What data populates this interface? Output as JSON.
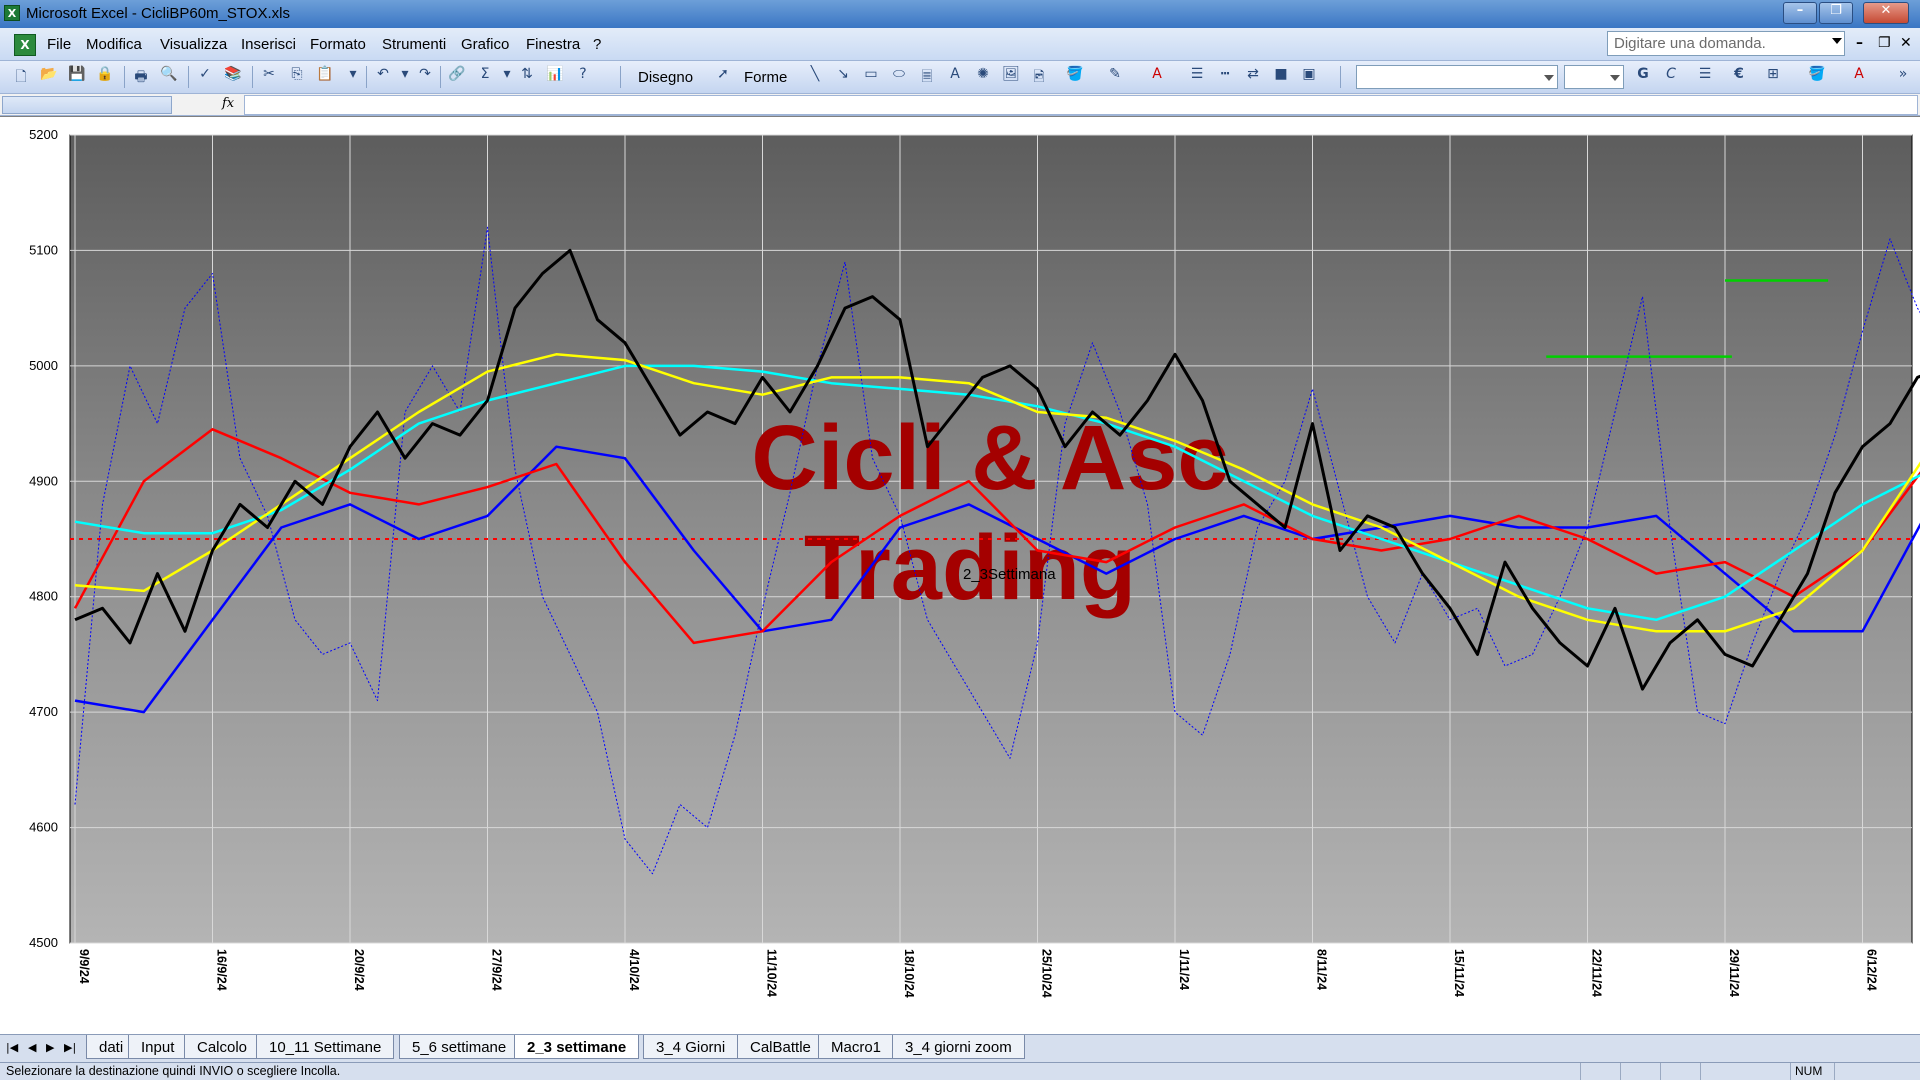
{
  "window": {
    "app_icon": "excel-app-icon",
    "title": "Microsoft Excel - CicliBP60m_STOX.xls",
    "buttons": {
      "minimize": "minimize-icon",
      "restore": "restore-icon",
      "close": "close-icon"
    }
  },
  "menu": {
    "items": [
      "File",
      "Modifica",
      "Visualizza",
      "Inserisci",
      "Formato",
      "Strumenti",
      "Grafico",
      "Finestra",
      "?"
    ],
    "ask_placeholder": "Digitare una domanda."
  },
  "toolbar": {
    "draw_label": "Disegno",
    "shapes_label": "Forme",
    "bold_label": "G",
    "italic_label": "C",
    "euro_label": "€",
    "sigma_label": "Σ"
  },
  "formula_bar": {
    "fx_label": "fx",
    "name_value": "",
    "formula_value": ""
  },
  "chart_data": {
    "type": "line",
    "watermark_lines": [
      "Cicli & Asc",
      "Trading"
    ],
    "chart_label": "2_3Settimana",
    "y_ticks": [
      "5200",
      "5100",
      "5000",
      "4900",
      "4800",
      "4700",
      "4600",
      "4500"
    ],
    "ylim": [
      4500,
      5200
    ],
    "x_ticks": [
      "9/9/24",
      "16/9/24",
      "20/9/24",
      "27/9/24",
      "4/10/24",
      "11/10/24",
      "18/10/24",
      "25/10/24",
      "1/11/24",
      "8/11/24",
      "15/11/24",
      "22/11/24",
      "29/11/24",
      "6/12/24"
    ],
    "reference_line": {
      "value": 4850,
      "color": "#ff0000"
    },
    "target_levels": [
      {
        "from_tick": 10.7,
        "to_tick": 12.05,
        "value": 5008,
        "color": "#00d000"
      },
      {
        "from_tick": 12.0,
        "to_tick": 12.75,
        "value": 5074,
        "color": "#00d000"
      }
    ],
    "series": [
      {
        "color": "#000000",
        "width": 3,
        "style": "solid",
        "points": [
          [
            0,
            4780
          ],
          [
            0.2,
            4790
          ],
          [
            0.4,
            4760
          ],
          [
            0.6,
            4820
          ],
          [
            0.8,
            4770
          ],
          [
            1.0,
            4840
          ],
          [
            1.2,
            4880
          ],
          [
            1.4,
            4860
          ],
          [
            1.6,
            4900
          ],
          [
            1.8,
            4880
          ],
          [
            2.0,
            4930
          ],
          [
            2.2,
            4960
          ],
          [
            2.4,
            4920
          ],
          [
            2.6,
            4950
          ],
          [
            2.8,
            4940
          ],
          [
            3.0,
            4970
          ],
          [
            3.2,
            5050
          ],
          [
            3.4,
            5080
          ],
          [
            3.6,
            5100
          ],
          [
            3.8,
            5040
          ],
          [
            4.0,
            5020
          ],
          [
            4.2,
            4980
          ],
          [
            4.4,
            4940
          ],
          [
            4.6,
            4960
          ],
          [
            4.8,
            4950
          ],
          [
            5.0,
            4990
          ],
          [
            5.2,
            4960
          ],
          [
            5.4,
            5000
          ],
          [
            5.6,
            5050
          ],
          [
            5.8,
            5060
          ],
          [
            6.0,
            5040
          ],
          [
            6.2,
            4930
          ],
          [
            6.4,
            4960
          ],
          [
            6.6,
            4990
          ],
          [
            6.8,
            5000
          ],
          [
            7.0,
            4980
          ],
          [
            7.2,
            4930
          ],
          [
            7.4,
            4960
          ],
          [
            7.6,
            4940
          ],
          [
            7.8,
            4970
          ],
          [
            8.0,
            5010
          ],
          [
            8.2,
            4970
          ],
          [
            8.4,
            4900
          ],
          [
            8.6,
            4880
          ],
          [
            8.8,
            4860
          ],
          [
            9.0,
            4950
          ],
          [
            9.2,
            4840
          ],
          [
            9.4,
            4870
          ],
          [
            9.6,
            4860
          ],
          [
            9.8,
            4820
          ],
          [
            10.0,
            4790
          ],
          [
            10.2,
            4750
          ],
          [
            10.4,
            4830
          ],
          [
            10.6,
            4790
          ],
          [
            10.8,
            4760
          ],
          [
            11.0,
            4740
          ],
          [
            11.2,
            4790
          ],
          [
            11.4,
            4720
          ],
          [
            11.6,
            4760
          ],
          [
            11.8,
            4780
          ],
          [
            12.0,
            4750
          ],
          [
            12.2,
            4740
          ],
          [
            12.4,
            4780
          ],
          [
            12.6,
            4820
          ],
          [
            12.8,
            4890
          ],
          [
            13.0,
            4930
          ],
          [
            13.2,
            4950
          ],
          [
            13.4,
            4990
          ],
          [
            13.6,
            5000
          ],
          [
            13.8,
            4990
          ]
        ]
      },
      {
        "color": "#ffff00",
        "width": 2.5,
        "style": "solid",
        "points": [
          [
            0,
            4810
          ],
          [
            0.5,
            4805
          ],
          [
            1.0,
            4840
          ],
          [
            1.5,
            4880
          ],
          [
            2.0,
            4920
          ],
          [
            2.5,
            4960
          ],
          [
            3.0,
            4995
          ],
          [
            3.5,
            5010
          ],
          [
            4.0,
            5005
          ],
          [
            4.5,
            4985
          ],
          [
            5.0,
            4975
          ],
          [
            5.5,
            4990
          ],
          [
            6.0,
            4990
          ],
          [
            6.5,
            4985
          ],
          [
            7.0,
            4960
          ],
          [
            7.5,
            4955
          ],
          [
            8.0,
            4935
          ],
          [
            8.5,
            4910
          ],
          [
            9.0,
            4880
          ],
          [
            9.5,
            4860
          ],
          [
            10.0,
            4830
          ],
          [
            10.5,
            4800
          ],
          [
            11.0,
            4780
          ],
          [
            11.5,
            4770
          ],
          [
            12.0,
            4770
          ],
          [
            12.5,
            4790
          ],
          [
            13.0,
            4840
          ],
          [
            13.5,
            4930
          ],
          [
            13.9,
            4970
          ]
        ]
      },
      {
        "color": "#00ffff",
        "width": 2.5,
        "style": "solid",
        "points": [
          [
            0,
            4865
          ],
          [
            0.5,
            4855
          ],
          [
            1.0,
            4855
          ],
          [
            1.5,
            4875
          ],
          [
            2.0,
            4910
          ],
          [
            2.5,
            4950
          ],
          [
            3.0,
            4970
          ],
          [
            3.5,
            4985
          ],
          [
            4.0,
            5000
          ],
          [
            4.5,
            5000
          ],
          [
            5.0,
            4995
          ],
          [
            5.5,
            4985
          ],
          [
            6.0,
            4980
          ],
          [
            6.5,
            4975
          ],
          [
            7.0,
            4965
          ],
          [
            7.5,
            4950
          ],
          [
            8.0,
            4930
          ],
          [
            8.5,
            4900
          ],
          [
            9.0,
            4870
          ],
          [
            9.5,
            4850
          ],
          [
            10.0,
            4830
          ],
          [
            10.5,
            4810
          ],
          [
            11.0,
            4790
          ],
          [
            11.5,
            4780
          ],
          [
            12.0,
            4800
          ],
          [
            12.5,
            4840
          ],
          [
            13.0,
            4880
          ],
          [
            13.5,
            4910
          ],
          [
            13.9,
            4935
          ]
        ]
      },
      {
        "color": "#ff0000",
        "width": 2.5,
        "style": "solid",
        "points": [
          [
            0,
            4790
          ],
          [
            0.5,
            4900
          ],
          [
            1.0,
            4945
          ],
          [
            1.5,
            4920
          ],
          [
            2.0,
            4890
          ],
          [
            2.5,
            4880
          ],
          [
            3.0,
            4895
          ],
          [
            3.5,
            4915
          ],
          [
            4.0,
            4830
          ],
          [
            4.5,
            4760
          ],
          [
            5.0,
            4770
          ],
          [
            5.5,
            4830
          ],
          [
            6.0,
            4870
          ],
          [
            6.5,
            4900
          ],
          [
            7.0,
            4840
          ],
          [
            7.5,
            4830
          ],
          [
            8.0,
            4860
          ],
          [
            8.5,
            4880
          ],
          [
            9.0,
            4850
          ],
          [
            9.5,
            4840
          ],
          [
            10.0,
            4850
          ],
          [
            10.5,
            4870
          ],
          [
            11.0,
            4850
          ],
          [
            11.5,
            4820
          ],
          [
            12.0,
            4830
          ],
          [
            12.5,
            4800
          ],
          [
            13.0,
            4840
          ],
          [
            13.5,
            4920
          ],
          [
            13.9,
            4860
          ]
        ]
      },
      {
        "color": "#0000ff",
        "width": 2.5,
        "style": "solid",
        "points": [
          [
            0,
            4710
          ],
          [
            0.5,
            4700
          ],
          [
            1.0,
            4780
          ],
          [
            1.5,
            4860
          ],
          [
            2.0,
            4880
          ],
          [
            2.5,
            4850
          ],
          [
            3.0,
            4870
          ],
          [
            3.5,
            4930
          ],
          [
            4.0,
            4920
          ],
          [
            4.5,
            4840
          ],
          [
            5.0,
            4770
          ],
          [
            5.5,
            4780
          ],
          [
            6.0,
            4860
          ],
          [
            6.5,
            4880
          ],
          [
            7.0,
            4850
          ],
          [
            7.5,
            4820
          ],
          [
            8.0,
            4850
          ],
          [
            8.5,
            4870
          ],
          [
            9.0,
            4850
          ],
          [
            9.5,
            4860
          ],
          [
            10.0,
            4870
          ],
          [
            10.5,
            4860
          ],
          [
            11.0,
            4860
          ],
          [
            11.5,
            4870
          ],
          [
            12.0,
            4820
          ],
          [
            12.5,
            4770
          ],
          [
            13.0,
            4770
          ],
          [
            13.5,
            4880
          ],
          [
            13.9,
            4950
          ]
        ]
      },
      {
        "color": "#0000ff",
        "width": 1,
        "style": "dotted",
        "points": [
          [
            0,
            4620
          ],
          [
            0.2,
            4880
          ],
          [
            0.4,
            5000
          ],
          [
            0.6,
            4950
          ],
          [
            0.8,
            5050
          ],
          [
            1.0,
            5080
          ],
          [
            1.2,
            4920
          ],
          [
            1.4,
            4870
          ],
          [
            1.6,
            4780
          ],
          [
            1.8,
            4750
          ],
          [
            2.0,
            4760
          ],
          [
            2.2,
            4710
          ],
          [
            2.4,
            4960
          ],
          [
            2.6,
            5000
          ],
          [
            2.8,
            4960
          ],
          [
            3.0,
            5120
          ],
          [
            3.2,
            4910
          ],
          [
            3.4,
            4800
          ],
          [
            3.6,
            4750
          ],
          [
            3.8,
            4700
          ],
          [
            4.0,
            4590
          ],
          [
            4.2,
            4560
          ],
          [
            4.4,
            4620
          ],
          [
            4.6,
            4600
          ],
          [
            4.8,
            4680
          ],
          [
            5.0,
            4790
          ],
          [
            5.2,
            4890
          ],
          [
            5.4,
            5000
          ],
          [
            5.6,
            5090
          ],
          [
            5.8,
            4920
          ],
          [
            6.0,
            4870
          ],
          [
            6.2,
            4780
          ],
          [
            6.4,
            4740
          ],
          [
            6.6,
            4700
          ],
          [
            6.8,
            4660
          ],
          [
            7.0,
            4760
          ],
          [
            7.2,
            4950
          ],
          [
            7.4,
            5020
          ],
          [
            7.6,
            4960
          ],
          [
            7.8,
            4880
          ],
          [
            8.0,
            4700
          ],
          [
            8.2,
            4680
          ],
          [
            8.4,
            4750
          ],
          [
            8.6,
            4860
          ],
          [
            8.8,
            4900
          ],
          [
            9.0,
            4980
          ],
          [
            9.2,
            4890
          ],
          [
            9.4,
            4800
          ],
          [
            9.6,
            4760
          ],
          [
            9.8,
            4820
          ],
          [
            10.0,
            4780
          ],
          [
            10.2,
            4790
          ],
          [
            10.4,
            4740
          ],
          [
            10.6,
            4750
          ],
          [
            10.8,
            4800
          ],
          [
            11.0,
            4860
          ],
          [
            11.2,
            4960
          ],
          [
            11.4,
            5060
          ],
          [
            11.6,
            4860
          ],
          [
            11.8,
            4700
          ],
          [
            12.0,
            4690
          ],
          [
            12.2,
            4760
          ],
          [
            12.4,
            4820
          ],
          [
            12.6,
            4870
          ],
          [
            12.8,
            4940
          ],
          [
            13.0,
            5030
          ],
          [
            13.2,
            5110
          ],
          [
            13.4,
            5050
          ],
          [
            13.6,
            5010
          ],
          [
            13.8,
            4950
          ],
          [
            13.95,
            4780
          ]
        ]
      }
    ]
  },
  "sheet_tabs": {
    "nav_icons": [
      "first-sheet-icon",
      "prev-sheet-icon",
      "next-sheet-icon",
      "last-sheet-icon"
    ],
    "tabs": [
      "dati",
      "Input",
      "Calcolo",
      "10_11 Settimane",
      "5_6 settimane",
      "2_3 settimane",
      "3_4 Giorni",
      "CalBattle",
      "Macro1",
      "3_4 giorni zoom"
    ],
    "active": "2_3 settimane"
  },
  "status_bar": {
    "message": "Selezionare la destinazione quindi INVIO o scegliere Incolla.",
    "num_label": "NUM"
  }
}
